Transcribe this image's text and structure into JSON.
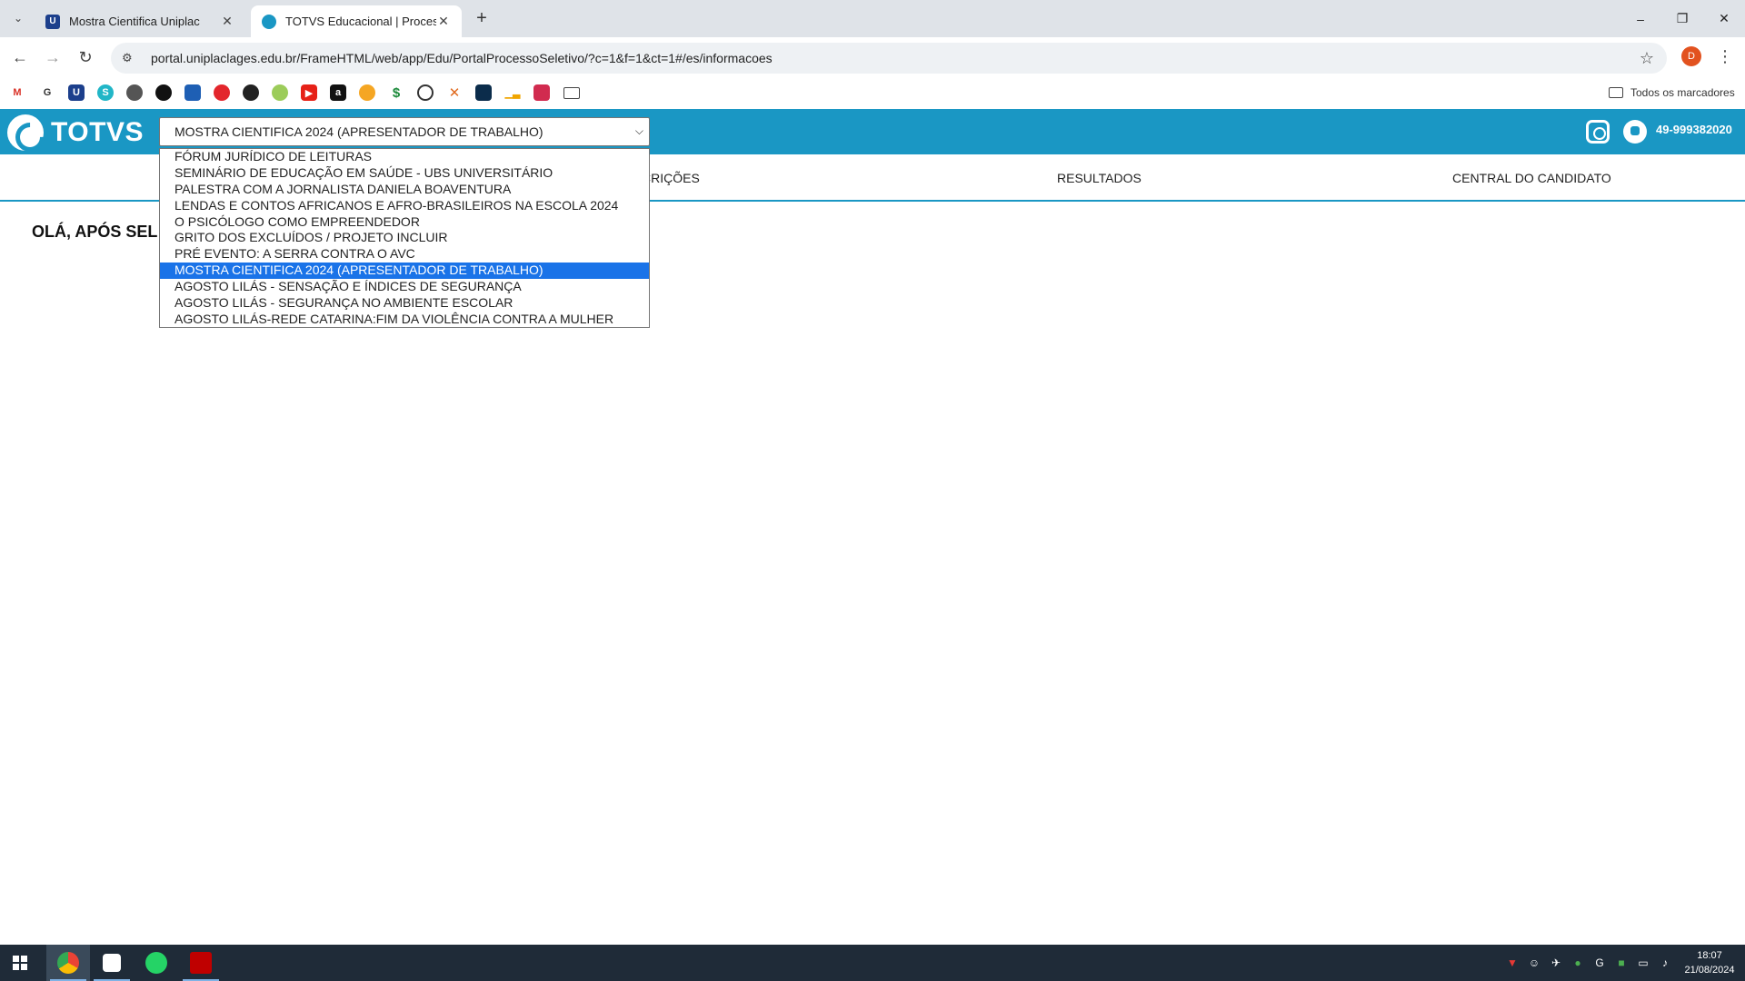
{
  "browser": {
    "tabs": [
      {
        "title": "Mostra Cientifica Uniplac",
        "favicon": "uniplac-u-icon",
        "active": false
      },
      {
        "title": "TOTVS Educacional | Processo S",
        "favicon": "totvs-icon",
        "active": true
      }
    ],
    "url": "portal.uniplaclages.edu.br/FrameHTML/web/app/Edu/PortalProcessoSeletivo/?c=1&f=1&ct=1#/es/informacoes",
    "profile_initial": "D",
    "all_bookmarks_label": "Todos os marcadores",
    "bookmark_icons": [
      "gmail-icon",
      "grammarly-icon",
      "bookmark-icon",
      "sapling-icon",
      "globe-icon",
      "openai-icon",
      "dashboard-icon",
      "red-circle-icon",
      "github-icon",
      "android-icon",
      "youtube-icon",
      "amazon-icon",
      "coin-icon",
      "dollar-icon",
      "block-icon",
      "x-icon",
      "terminal-icon",
      "chart-icon",
      "cube-icon",
      "folder-icon"
    ]
  },
  "page": {
    "brand": "TOTVS",
    "selected_event": "MOSTRA CIENTIFICA 2024 (APRESENTADOR DE TRABALHO)",
    "phone": "49-999382020",
    "menu": {
      "inscricoes": "CRIÇÕES",
      "resultados": "RESULTADOS",
      "central": "CENTRAL DO CANDIDATO"
    },
    "greeting": "OLÁ, APÓS SEL",
    "dropdown_options": [
      "FÓRUM JURÍDICO DE LEITURAS",
      "SEMINÁRIO DE EDUCAÇÃO EM SAÚDE - UBS UNIVERSITÁRIO",
      "PALESTRA COM A JORNALISTA DANIELA BOAVENTURA",
      "LENDAS E CONTOS AFRICANOS E AFRO-BRASILEIROS NA ESCOLA 2024",
      "O PSICÓLOGO COMO EMPREENDEDOR",
      "GRITO DOS EXCLUÍDOS / PROJETO INCLUIR",
      "PRÉ EVENTO: A SERRA CONTRA O AVC",
      "MOSTRA CIENTIFICA 2024 (APRESENTADOR DE TRABALHO)",
      "AGOSTO LILÁS - SENSAÇÃO E ÍNDICES DE SEGURANÇA",
      "AGOSTO LILÁS - SEGURANÇA NO AMBIENTE ESCOLAR",
      "AGOSTO LILÁS-REDE CATARINA:FIM DA VIOLÊNCIA CONTRA A MULHER"
    ],
    "selected_index": 7
  },
  "taskbar": {
    "apps": [
      "chrome-icon",
      "inkscape-icon",
      "whatsapp-icon",
      "filezilla-icon"
    ],
    "time": "18:07",
    "date": "21/08/2024"
  },
  "colors": {
    "brand_blue": "#1a97c4",
    "selection_blue": "#1a73e8",
    "taskbar": "#1f2b38"
  }
}
